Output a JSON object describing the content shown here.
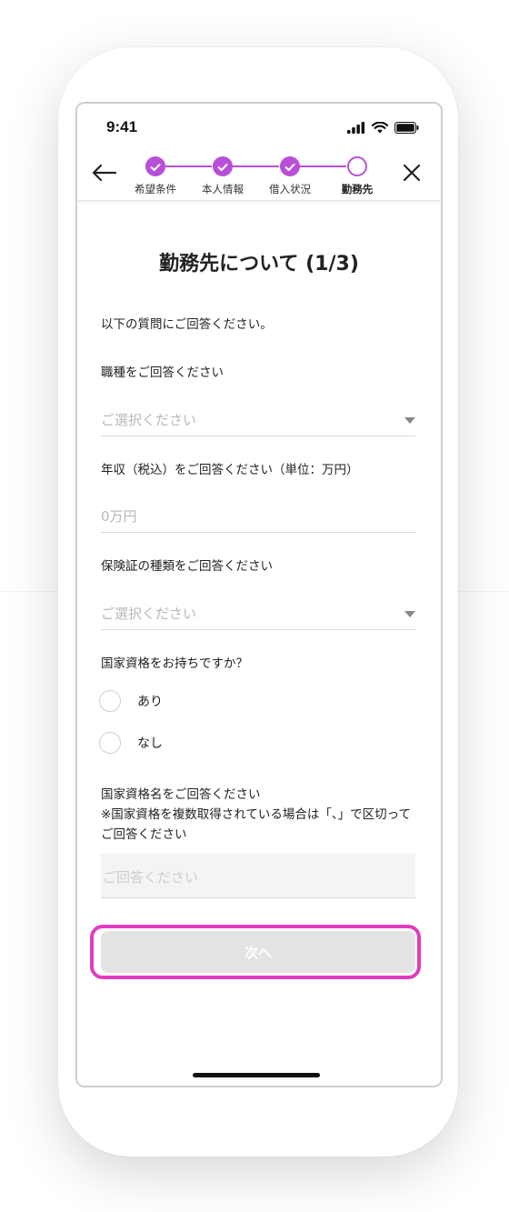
{
  "status_bar": {
    "time": "9:41"
  },
  "stepper": {
    "steps": [
      {
        "label": "希望条件",
        "state": "done"
      },
      {
        "label": "本人情報",
        "state": "done"
      },
      {
        "label": "借入状況",
        "state": "done"
      },
      {
        "label": "勤務先",
        "state": "current"
      }
    ]
  },
  "page": {
    "title": "勤務先について (1/3)",
    "intro": "以下の質問にご回答ください。"
  },
  "form": {
    "occupation": {
      "label": "職種をご回答ください",
      "placeholder": "ご選択ください"
    },
    "income": {
      "label": "年収（税込）をご回答ください（単位：万円）",
      "placeholder": "0万円"
    },
    "insurance": {
      "label": "保険証の種類をご回答ください",
      "placeholder": "ご選択ください"
    },
    "license": {
      "question": "国家資格をお持ちですか？",
      "options": [
        "あり",
        "なし"
      ],
      "name_label_line1": "国家資格名をご回答ください",
      "name_label_line2": "※国家資格を複数取得されている場合は「、」で区切ってご回答ください",
      "name_placeholder": "ご回答ください"
    }
  },
  "actions": {
    "next_label": "次へ"
  },
  "colors": {
    "accent": "#b84fd8",
    "highlight": "#e23cbf",
    "button_disabled": "#e3e3e3"
  }
}
